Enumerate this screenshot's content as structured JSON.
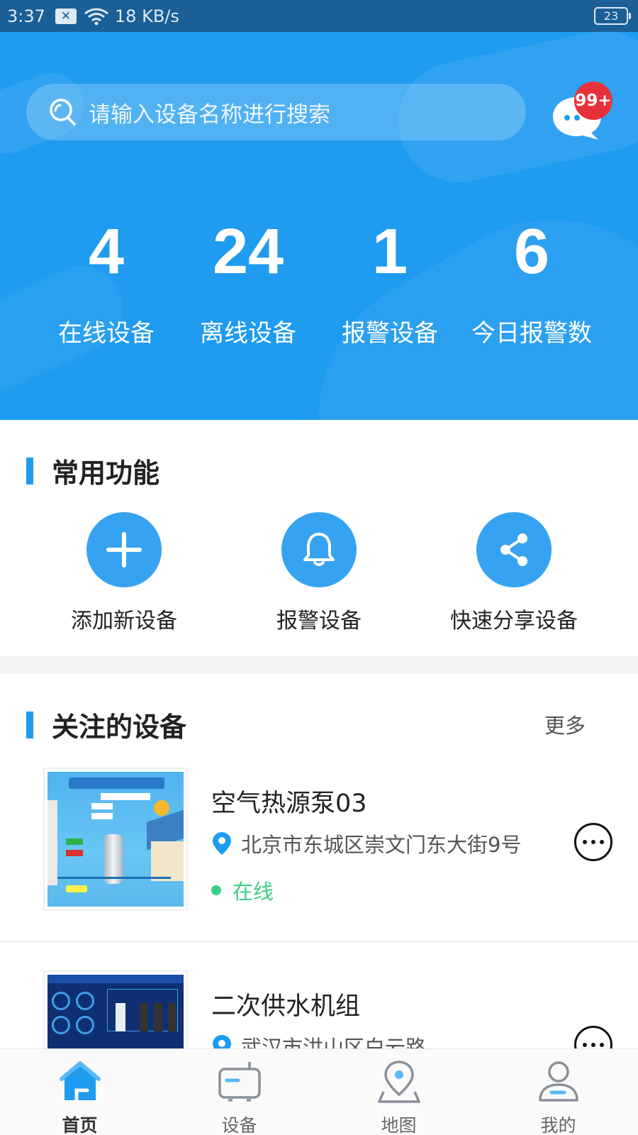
{
  "status_bar": {
    "time": "3:37",
    "network_speed": "18 KB/s",
    "battery": "23"
  },
  "search": {
    "placeholder": "请输入设备名称进行搜索"
  },
  "messages": {
    "badge": "99+"
  },
  "stats": [
    {
      "value": "4",
      "label": "在线设备"
    },
    {
      "value": "24",
      "label": "离线设备"
    },
    {
      "value": "1",
      "label": "报警设备"
    },
    {
      "value": "6",
      "label": "今日报警数"
    }
  ],
  "common_functions": {
    "title": "常用功能",
    "items": [
      {
        "label": "添加新设备",
        "icon": "plus-icon"
      },
      {
        "label": "报警设备",
        "icon": "bell-icon"
      },
      {
        "label": "快速分享设备",
        "icon": "share-icon"
      }
    ]
  },
  "followed_devices": {
    "title": "关注的设备",
    "more_label": "更多",
    "items": [
      {
        "name": "空气热源泵03",
        "address": "北京市东城区崇文门东大街9号",
        "status": "在线"
      },
      {
        "name": "二次供水机组",
        "address": "武汉市洪山区白云路",
        "status": ""
      }
    ]
  },
  "tabbar": {
    "items": [
      {
        "label": "首页",
        "icon": "home-icon",
        "active": true
      },
      {
        "label": "设备",
        "icon": "device-icon",
        "active": false
      },
      {
        "label": "地图",
        "icon": "map-icon",
        "active": false
      },
      {
        "label": "我的",
        "icon": "profile-icon",
        "active": false
      }
    ]
  },
  "colors": {
    "accent": "#1f9bf0",
    "status_bar": "#1a5f96",
    "online": "#3bcf86",
    "badge": "#e8323b"
  }
}
